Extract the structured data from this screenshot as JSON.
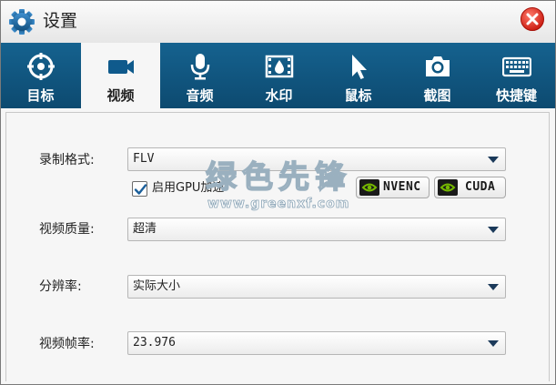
{
  "window": {
    "title": "设置",
    "icons": {
      "title": "gear-icon",
      "close": "close-icon"
    }
  },
  "tabs": [
    {
      "label": "目标",
      "icon": "target-icon",
      "active": false
    },
    {
      "label": "视频",
      "icon": "video-camera-icon",
      "active": true
    },
    {
      "label": "音频",
      "icon": "microphone-icon",
      "active": false
    },
    {
      "label": "水印",
      "icon": "watermark-icon",
      "active": false
    },
    {
      "label": "鼠标",
      "icon": "cursor-icon",
      "active": false
    },
    {
      "label": "截图",
      "icon": "camera-icon",
      "active": false
    },
    {
      "label": "快捷键",
      "icon": "keyboard-icon",
      "active": false
    }
  ],
  "video": {
    "format": {
      "label": "录制格式:",
      "value": "FLV"
    },
    "gpu": {
      "label": "启用GPU加速",
      "checked": true
    },
    "badges": [
      {
        "text": "NVENC",
        "icon": "nvidia-icon"
      },
      {
        "text": "CUDA",
        "icon": "nvidia-icon"
      }
    ],
    "quality": {
      "label": "视频质量:",
      "value": "超清"
    },
    "resolution": {
      "label": "分辨率:",
      "value": "实际大小"
    },
    "framerate": {
      "label": "视频帧率:",
      "value": "23.976"
    }
  },
  "watermark": {
    "text": "绿色先锋",
    "url": "www.greenxf.com"
  },
  "colors": {
    "tabbar": "#0f5680",
    "accent": "#1b6fae",
    "close": "#e3342a"
  }
}
